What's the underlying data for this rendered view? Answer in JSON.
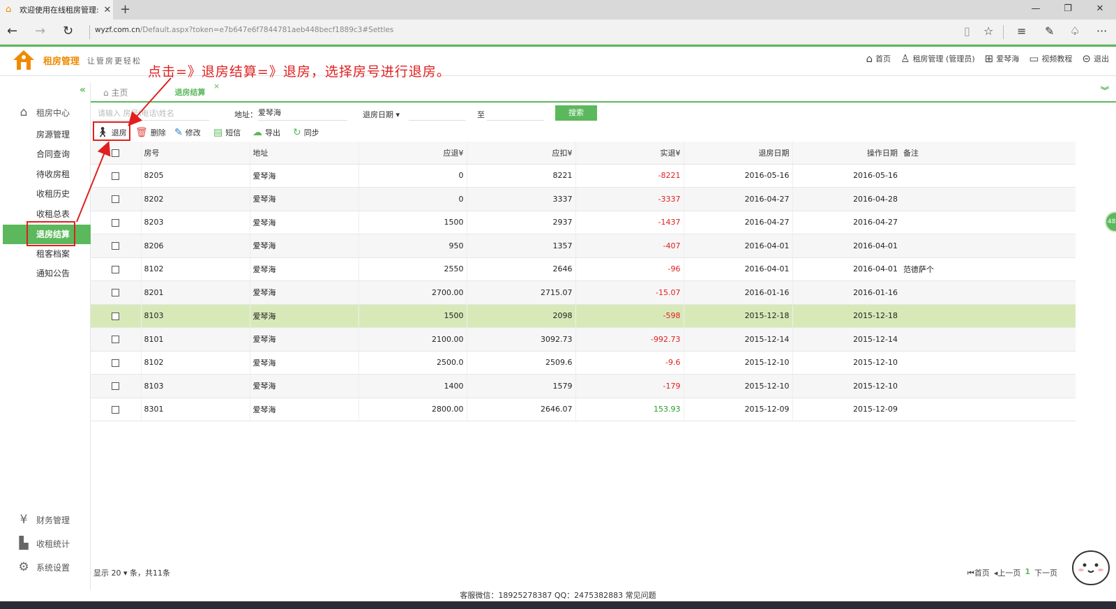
{
  "browser": {
    "tab_title": "欢迎使用在线租房管理:",
    "url_host": "wyzf.com.cn",
    "url_path": "/Default.aspx?token=e7b647e6f7844781aeb448becf1889c3#Settles"
  },
  "app": {
    "name": "租房管理",
    "slogan": "让管房更轻松",
    "topnav": [
      {
        "icon": "home-icon",
        "label": "首页"
      },
      {
        "icon": "user-icon",
        "label": "租房管理 (管理员)"
      },
      {
        "icon": "org-icon",
        "label": "爱琴海"
      },
      {
        "icon": "video-icon",
        "label": "视频教程"
      },
      {
        "icon": "logout-icon",
        "label": "退出"
      }
    ]
  },
  "annotation": "点击=》退房结算=》退房，选择房号进行退房。",
  "sidebar": {
    "section": "租房中心",
    "items": [
      "房源管理",
      "合同查询",
      "待收房租",
      "收租历史",
      "收租总表",
      "退房结算",
      "租客档案",
      "通知公告"
    ],
    "active": "退房结算",
    "bottom": [
      "财务管理",
      "收租统计",
      "系统设置"
    ]
  },
  "page_tabs": {
    "home": "主页",
    "active": "退房结算"
  },
  "search": {
    "placeholder": "请输入 房号\\电话\\姓名",
    "address_label": "地址：",
    "address_value": "爱琴海",
    "date_label": "退房日期",
    "to_label": "至",
    "button": "搜索"
  },
  "toolbar": [
    "退房",
    "删除",
    "修改",
    "短信",
    "导出",
    "同步"
  ],
  "table": {
    "headers": [
      "房号",
      "地址",
      "应退¥",
      "应扣¥",
      "实退¥",
      "退房日期",
      "操作日期",
      "备注"
    ],
    "rows": [
      {
        "room": "8205",
        "addr": "爱琴海",
        "refund": "0",
        "deduct": "8221",
        "actual": "-8221",
        "out": "2016-05-16",
        "op": "2016-05-16",
        "note": ""
      },
      {
        "room": "8202",
        "addr": "爱琴海",
        "refund": "0",
        "deduct": "3337",
        "actual": "-3337",
        "out": "2016-04-27",
        "op": "2016-04-28",
        "note": ""
      },
      {
        "room": "8203",
        "addr": "爱琴海",
        "refund": "1500",
        "deduct": "2937",
        "actual": "-1437",
        "out": "2016-04-27",
        "op": "2016-04-27",
        "note": ""
      },
      {
        "room": "8206",
        "addr": "爱琴海",
        "refund": "950",
        "deduct": "1357",
        "actual": "-407",
        "out": "2016-04-01",
        "op": "2016-04-01",
        "note": ""
      },
      {
        "room": "8102",
        "addr": "爱琴海",
        "refund": "2550",
        "deduct": "2646",
        "actual": "-96",
        "out": "2016-04-01",
        "op": "2016-04-01",
        "note": "范德萨个"
      },
      {
        "room": "8201",
        "addr": "爱琴海",
        "refund": "2700.00",
        "deduct": "2715.07",
        "actual": "-15.07",
        "out": "2016-01-16",
        "op": "2016-01-16",
        "note": ""
      },
      {
        "room": "8103",
        "addr": "爱琴海",
        "refund": "1500",
        "deduct": "2098",
        "actual": "-598",
        "out": "2015-12-18",
        "op": "2015-12-18",
        "note": ""
      },
      {
        "room": "8101",
        "addr": "爱琴海",
        "refund": "2100.00",
        "deduct": "3092.73",
        "actual": "-992.73",
        "out": "2015-12-14",
        "op": "2015-12-14",
        "note": ""
      },
      {
        "room": "8102",
        "addr": "爱琴海",
        "refund": "2500.0",
        "deduct": "2509.6",
        "actual": "-9.6",
        "out": "2015-12-10",
        "op": "2015-12-10",
        "note": ""
      },
      {
        "room": "8103",
        "addr": "爱琴海",
        "refund": "1400",
        "deduct": "1579",
        "actual": "-179",
        "out": "2015-12-10",
        "op": "2015-12-10",
        "note": ""
      },
      {
        "room": "8301",
        "addr": "爱琴海",
        "refund": "2800.00",
        "deduct": "2646.07",
        "actual": "153.93",
        "out": "2015-12-09",
        "op": "2015-12-09",
        "note": ""
      }
    ],
    "selected_index": 6
  },
  "footer": {
    "show_prefix": "显示",
    "page_size": "20",
    "show_suffix": "条，共11条",
    "pager": {
      "first": "首页",
      "prev": "上一页",
      "current": "1",
      "next": "下一页"
    },
    "site": "客服微信：18925278387   QQ：2475382883     常见问题"
  },
  "bubble": "48",
  "colors": {
    "accent": "#5cb85c",
    "brand_orange": "#f08a00",
    "negative": "#e02020",
    "positive": "#2a9a2a",
    "selected_row": "#d8e9b8"
  }
}
